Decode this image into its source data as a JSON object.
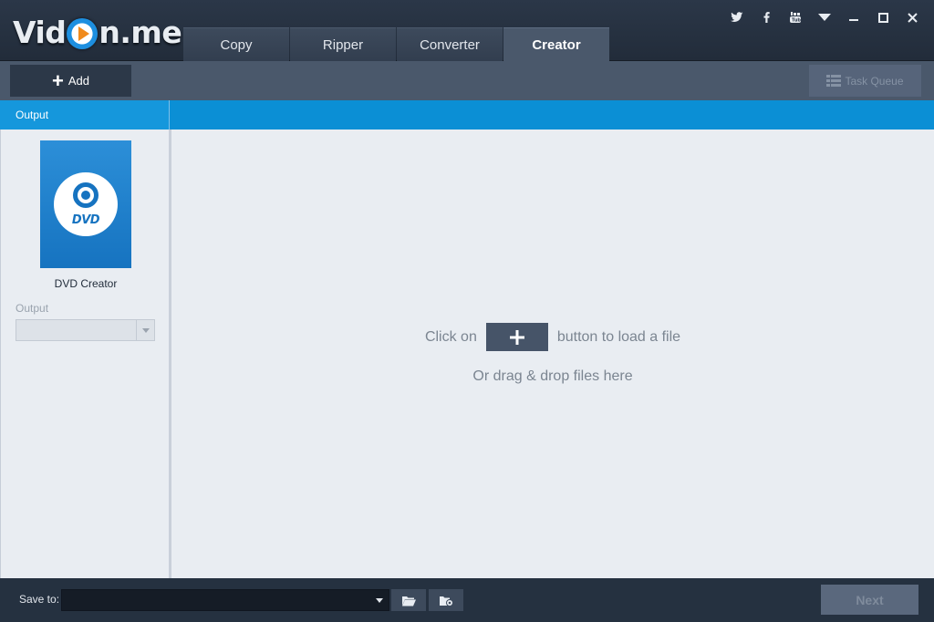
{
  "app": {
    "logo_left": "Vid",
    "logo_right": "n.me"
  },
  "tabs": [
    {
      "label": "Copy"
    },
    {
      "label": "Ripper"
    },
    {
      "label": "Converter"
    },
    {
      "label": "Creator",
      "active": true
    }
  ],
  "toolbar": {
    "add_label": "Add",
    "task_queue_label": "Task Queue"
  },
  "left_panel": {
    "header": "Output",
    "card_icon_text": "DVD",
    "card_label": "DVD Creator",
    "output_label": "Output",
    "output_value": ""
  },
  "main": {
    "hint_prefix": "Click on",
    "hint_suffix": "button to load a file",
    "hint_drag": "Or drag & drop files here"
  },
  "bottom": {
    "save_to_label": "Save to:",
    "save_path": "",
    "next_label": "Next"
  },
  "colors": {
    "accent_blue": "#0b8fd5",
    "titlebar": "#2b3748",
    "toolbar": "#4a586b",
    "logo_play": "#f08a1c"
  },
  "icons": [
    "twitter-icon",
    "facebook-icon",
    "youtube-icon",
    "dropdown-menu-icon",
    "minimize-icon",
    "maximize-icon",
    "close-icon"
  ]
}
